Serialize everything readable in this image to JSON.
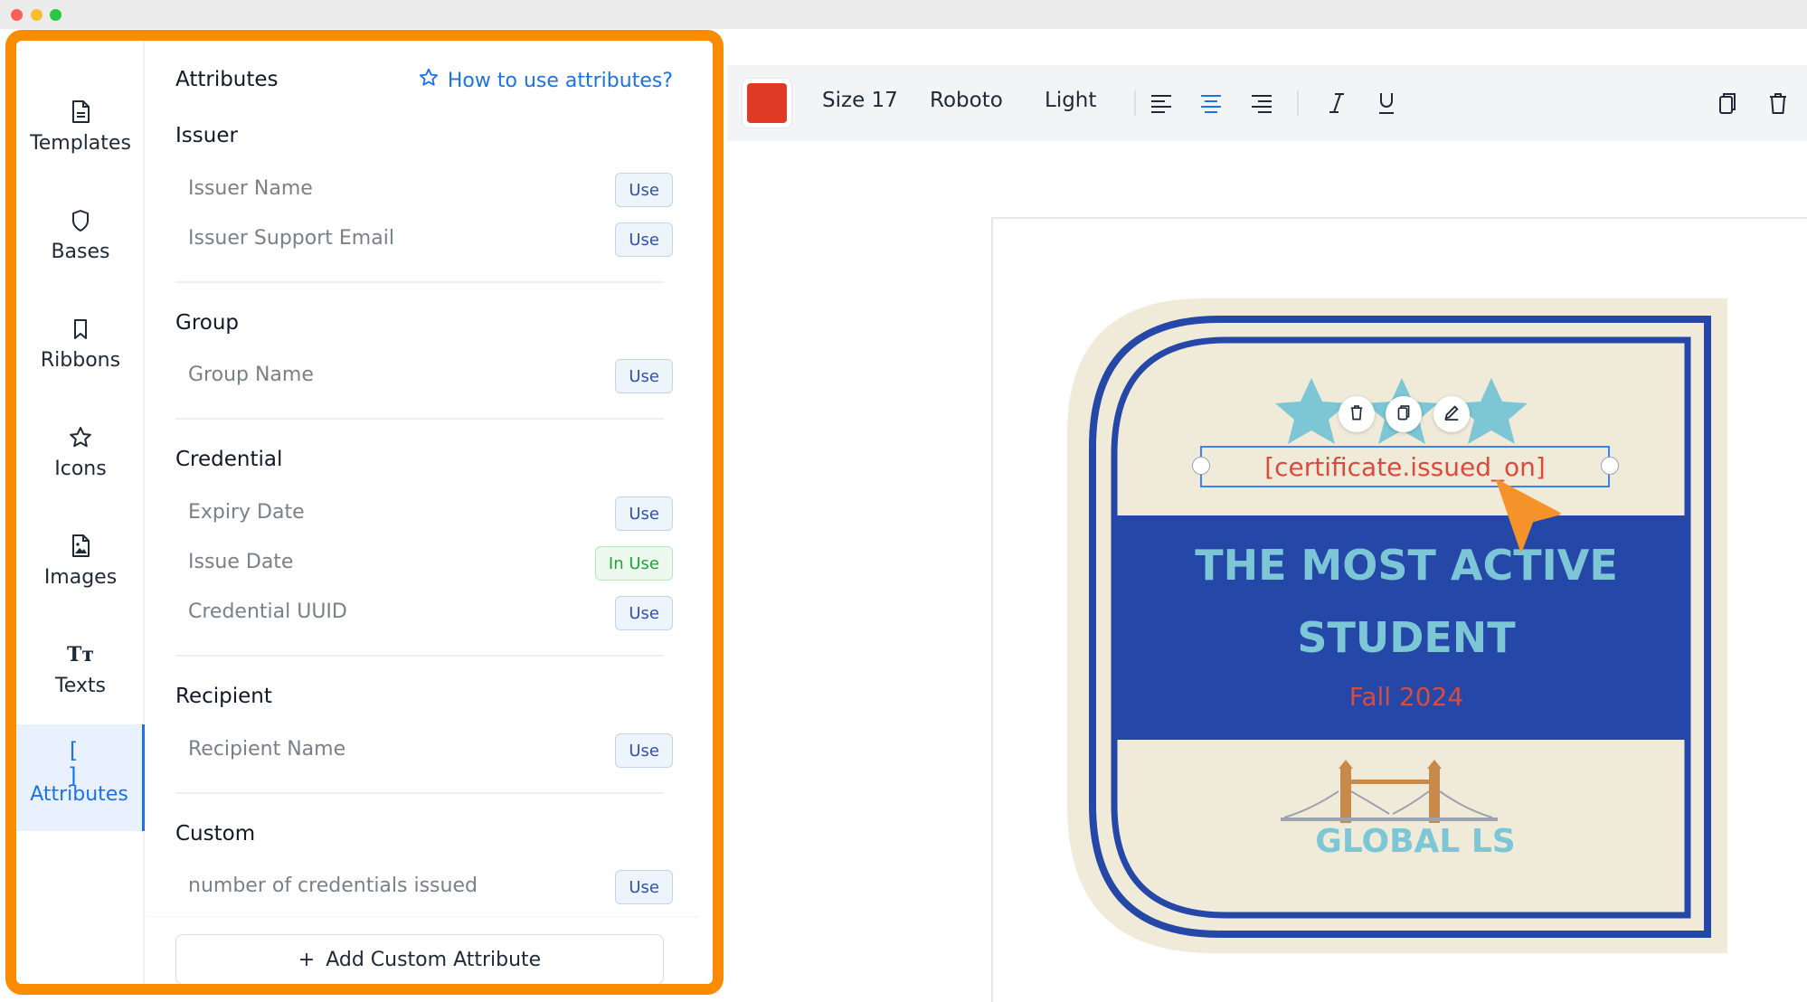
{
  "sidebar": {
    "items": [
      {
        "label": "Templates",
        "icon": "file-icon"
      },
      {
        "label": "Bases",
        "icon": "shield-icon"
      },
      {
        "label": "Ribbons",
        "icon": "bookmark-icon"
      },
      {
        "label": "Icons",
        "icon": "star-icon"
      },
      {
        "label": "Images",
        "icon": "image-file-icon"
      },
      {
        "label": "Texts",
        "icon": "text-icon",
        "glyph": "Tт"
      },
      {
        "label": "Attributes",
        "icon": "brackets-icon",
        "glyph": "[ ]",
        "active": true
      }
    ]
  },
  "attributes": {
    "title": "Attributes",
    "help_link": "How to use attributes?",
    "sections": [
      {
        "title": "Issuer",
        "rows": [
          {
            "label": "Issuer Name",
            "action": "Use"
          },
          {
            "label": "Issuer Support Email",
            "action": "Use"
          }
        ]
      },
      {
        "title": "Group",
        "rows": [
          {
            "label": "Group Name",
            "action": "Use"
          }
        ]
      },
      {
        "title": "Credential",
        "rows": [
          {
            "label": "Expiry Date",
            "action": "Use"
          },
          {
            "label": "Issue Date",
            "action": "In Use"
          },
          {
            "label": "Credential UUID",
            "action": "Use"
          }
        ]
      },
      {
        "title": "Recipient",
        "rows": [
          {
            "label": "Recipient Name",
            "action": "Use"
          }
        ]
      },
      {
        "title": "Custom",
        "rows": [
          {
            "label": "number of credentials issued",
            "action": "Use"
          }
        ]
      }
    ],
    "add_button": {
      "icon": "+",
      "label": "Add Custom Attribute"
    }
  },
  "toolbar": {
    "color": "#e03b24",
    "size": "Size 17",
    "font": "Roboto",
    "weight": "Light",
    "align_active": "center"
  },
  "badge": {
    "field_text": "[certificate.issued_on]",
    "headline_line1": "THE MOST ACTIVE",
    "headline_line2": "STUDENT",
    "subline": "Fall 2024",
    "org": "GLOBAL LS",
    "colors": {
      "navy": "#2447a8",
      "cream": "#f0ead9",
      "teal": "#7cc6d6",
      "red": "#d94c3d",
      "accent_orange": "#fb8c00"
    }
  }
}
